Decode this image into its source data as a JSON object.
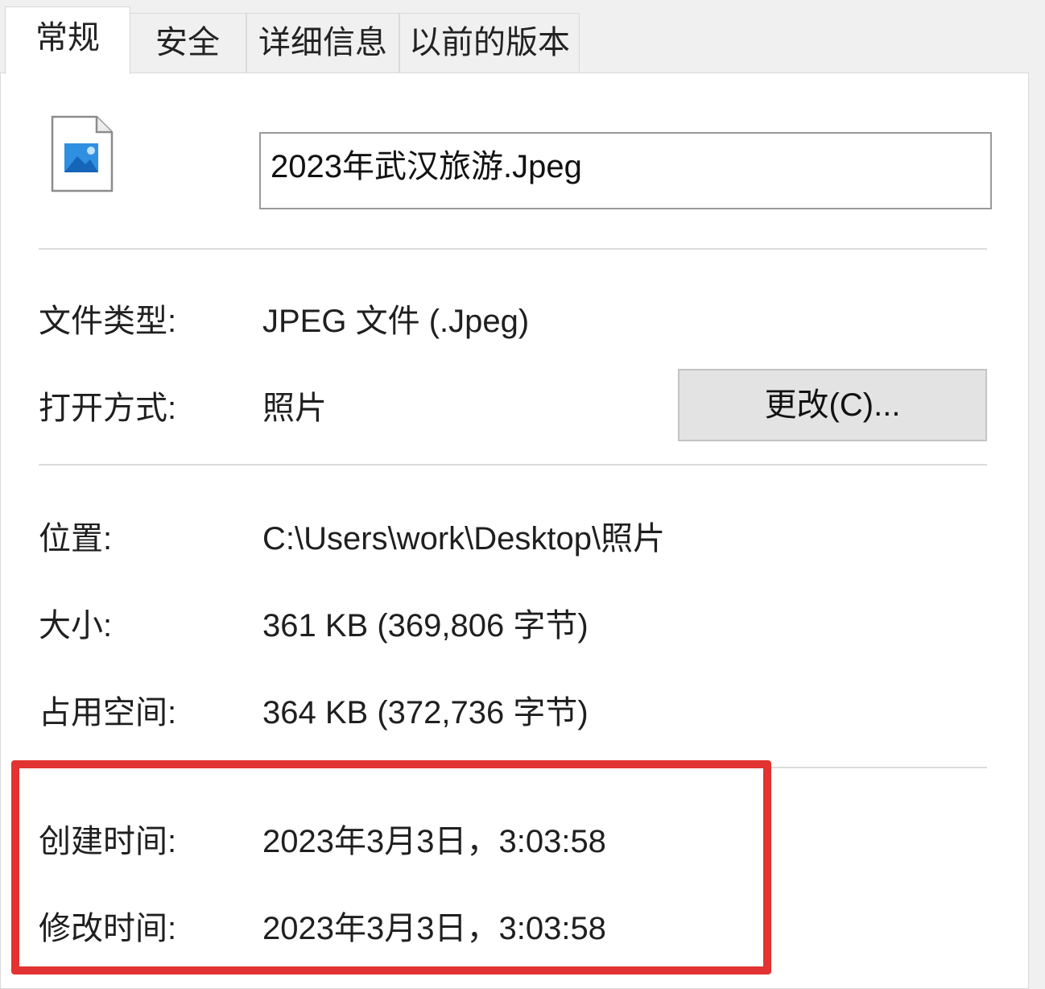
{
  "tabs": [
    {
      "label": "常规",
      "active": true
    },
    {
      "label": "安全",
      "active": false
    },
    {
      "label": "详细信息",
      "active": false
    },
    {
      "label": "以前的版本",
      "active": false
    }
  ],
  "file": {
    "icon": "image-file-icon",
    "name": "2023年武汉旅游.Jpeg"
  },
  "properties": {
    "type_label": "文件类型:",
    "type_value": "JPEG 文件 (.Jpeg)",
    "opens_with_label": "打开方式:",
    "opens_with_value": "照片",
    "change_button": "更改(C)...",
    "location_label": "位置:",
    "location_value": "C:\\Users\\work\\Desktop\\照片",
    "size_label": "大小:",
    "size_value": "361 KB (369,806 字节)",
    "disk_size_label": "占用空间:",
    "disk_size_value": "364 KB (372,736 字节)",
    "created_label": "创建时间:",
    "created_value": "2023年3月3日，3:03:58",
    "modified_label": "修改时间:",
    "modified_value": "2023年3月3日，3:03:58"
  },
  "colors": {
    "highlight": "#e23232",
    "panel": "#ffffff",
    "chrome": "#f0f0f0"
  }
}
